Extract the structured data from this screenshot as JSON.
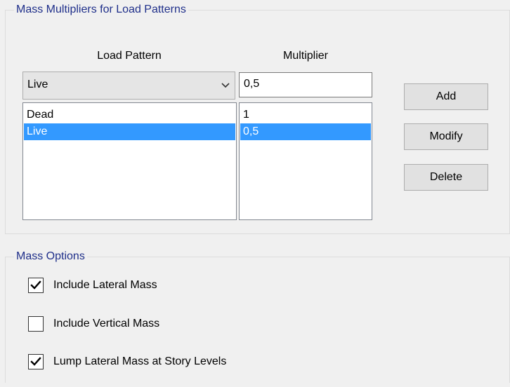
{
  "mass_multipliers": {
    "group_title": "Mass Multipliers for Load Patterns",
    "load_pattern_header": "Load Pattern",
    "multiplier_header": "Multiplier",
    "combo_value": "Live",
    "multiplier_input_value": "0,5",
    "load_patterns": [
      {
        "label": "Dead",
        "selected": false
      },
      {
        "label": "Live",
        "selected": true
      }
    ],
    "multipliers": [
      {
        "label": "1",
        "selected": false
      },
      {
        "label": "0,5",
        "selected": true
      }
    ],
    "buttons": {
      "add": "Add",
      "modify": "Modify",
      "delete": "Delete"
    }
  },
  "mass_options": {
    "group_title": "Mass Options",
    "options": [
      {
        "label": "Include Lateral Mass",
        "checked": true
      },
      {
        "label": "Include Vertical Mass",
        "checked": false
      },
      {
        "label": "Lump Lateral Mass at Story Levels",
        "checked": true
      }
    ]
  },
  "colors": {
    "selection": "#3399ff",
    "group_title": "#1f2f8a",
    "background": "#f0f0f0"
  }
}
